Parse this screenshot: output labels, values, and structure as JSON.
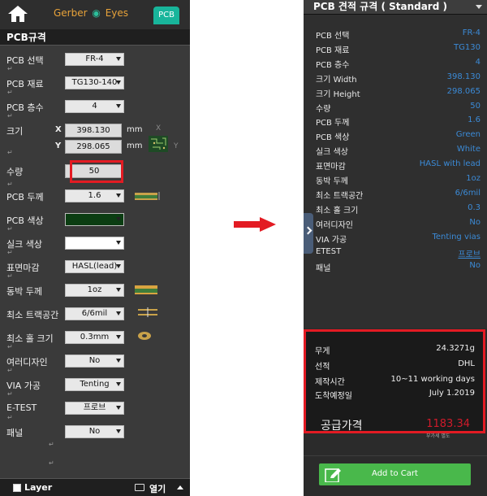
{
  "left": {
    "brand": {
      "part1": "Gerber",
      "part2": "Eyes"
    },
    "pcb_tab": "PCB",
    "section_title": "PCB규격",
    "rows": {
      "board_type": {
        "label": "PCB 선택",
        "value": "FR-4"
      },
      "material": {
        "label": "PCB 재료",
        "value": "TG130-140"
      },
      "layers": {
        "label": "PCB 층수",
        "value": "4"
      },
      "size": {
        "label": "크기",
        "x_label": "X",
        "y_label": "Y",
        "x_value": "398.130",
        "y_value": "298.065",
        "unit": "mm",
        "x_dim": "X",
        "y_dim": "Y"
      },
      "quantity": {
        "label": "수량",
        "value": "50"
      },
      "thickness": {
        "label": "PCB 두께",
        "value": "1.6"
      },
      "solder_color": {
        "label": "PCB 색상",
        "color": "#0b3d12"
      },
      "silk_color": {
        "label": "실크 색상",
        "color": "#ffffff"
      },
      "finish": {
        "label": "표면마감",
        "value": "HASL(lead)"
      },
      "copper": {
        "label": "동박 두께",
        "value": "1oz"
      },
      "min_track": {
        "label": "최소 트랙공간",
        "value": "6/6mil"
      },
      "min_hole": {
        "label": "최소 홀 크기",
        "value": "0.3mm"
      },
      "multi_design": {
        "label": "여러디자인",
        "value": "No"
      },
      "via": {
        "label": "VIA 가공",
        "value": "Tenting"
      },
      "etest": {
        "label": "E-TEST",
        "value": "프로브"
      },
      "panel": {
        "label": "패널",
        "value": "No"
      }
    },
    "bottom": {
      "layer_label": "Layer",
      "open_label": "열기"
    }
  },
  "right": {
    "header": "PCB 견적 규격 ( Standard )",
    "specs": [
      {
        "k": "PCB 선택",
        "v": "FR-4"
      },
      {
        "k": "PCB 재료",
        "v": "TG130"
      },
      {
        "k": "PCB 층수",
        "v": "4"
      },
      {
        "k": "크기 Width",
        "v": "398.130"
      },
      {
        "k": "크기 Height",
        "v": "298.065"
      },
      {
        "k": "수량",
        "v": "50"
      },
      {
        "k": "PCB 두께",
        "v": "1.6"
      },
      {
        "k": "PCB 색상",
        "v": "Green"
      },
      {
        "k": "실크 색상",
        "v": "White"
      },
      {
        "k": "표면마감",
        "v": "HASL with lead"
      },
      {
        "k": "동박 두께",
        "v": "1oz"
      },
      {
        "k": "최소 트랙공간",
        "v": "6/6mil"
      },
      {
        "k": "최소 홀 크기",
        "v": "0.3"
      },
      {
        "k": "여러디자인",
        "v": "No"
      },
      {
        "k": "VIA 가공",
        "v": "Tenting vias"
      },
      {
        "k": "ETEST",
        "v": "프로브"
      },
      {
        "k": "패널",
        "v": "No"
      }
    ],
    "summary": {
      "weight": {
        "k": "무게",
        "v": "24.3271g"
      },
      "shipping": {
        "k": "선적",
        "v": "DHL"
      },
      "lead_time": {
        "k": "제작시간",
        "v": "10~11 working days"
      },
      "arrival": {
        "k": "도착예정일",
        "v": "July 1.2019"
      },
      "price": {
        "k": "공급가격",
        "v": "1183.34",
        "note": "부가세 별도"
      }
    },
    "cart_label": "Add to Cart"
  },
  "colors": {
    "accent": "#18b59b",
    "highlight": "#e31b23",
    "link": "#3b8ad6",
    "cart": "#49b84b"
  }
}
